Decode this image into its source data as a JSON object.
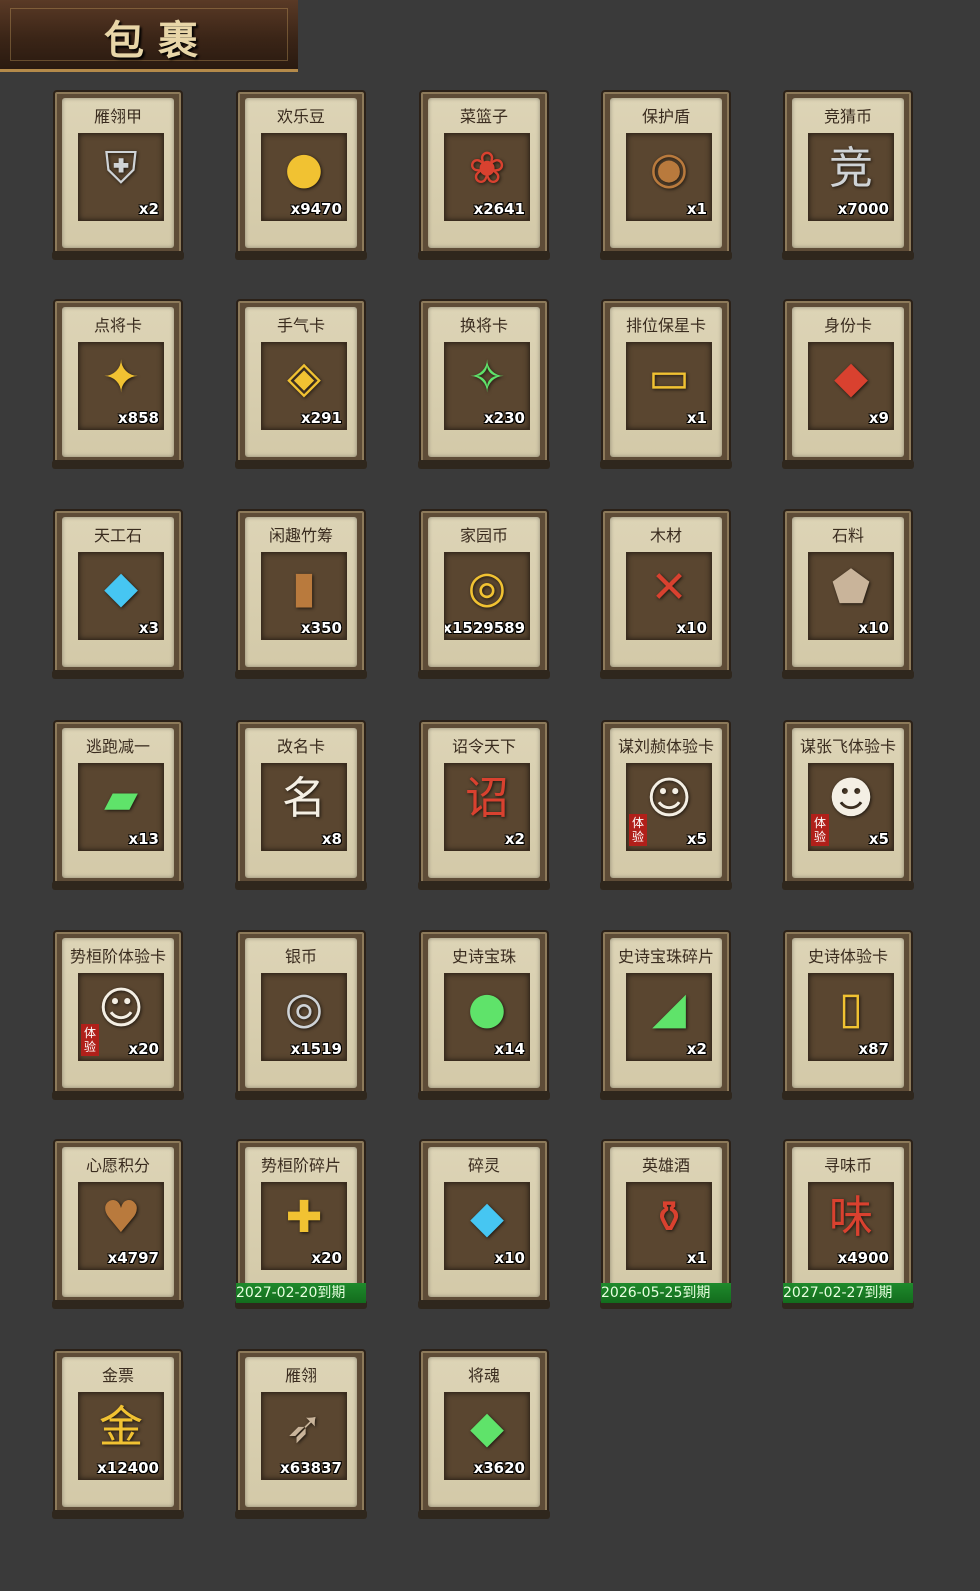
{
  "header": {
    "title": "包裹"
  },
  "items": [
    {
      "name": "雁翎甲",
      "qty": "x2",
      "icon": "armor-icon",
      "glyph": "⛨",
      "theme": "t-silver"
    },
    {
      "name": "欢乐豆",
      "qty": "x9470",
      "icon": "beans-icon",
      "glyph": "●",
      "theme": "t-gold"
    },
    {
      "name": "菜篮子",
      "qty": "x2641",
      "icon": "basket-icon",
      "glyph": "❀",
      "theme": "t-red"
    },
    {
      "name": "保护盾",
      "qty": "x1",
      "icon": "shield-icon",
      "glyph": "◉",
      "theme": "t-brown"
    },
    {
      "name": "竞猜币",
      "qty": "x7000",
      "icon": "coin-icon",
      "glyph": "竞",
      "theme": "t-silver"
    },
    {
      "name": "点将卡",
      "qty": "x858",
      "icon": "card-token-icon",
      "glyph": "✦",
      "theme": "t-gold"
    },
    {
      "name": "手气卡",
      "qty": "x291",
      "icon": "luck-card-icon",
      "glyph": "◈",
      "theme": "t-gold"
    },
    {
      "name": "换将卡",
      "qty": "x230",
      "icon": "swap-card-icon",
      "glyph": "✧",
      "theme": "t-green"
    },
    {
      "name": "排位保星卡",
      "qty": "x1",
      "icon": "rank-card-icon",
      "glyph": "▭",
      "theme": "t-gold"
    },
    {
      "name": "身份卡",
      "qty": "x9",
      "icon": "identity-card-icon",
      "glyph": "◆",
      "theme": "t-red"
    },
    {
      "name": "天工石",
      "qty": "x3",
      "icon": "crystal-icon",
      "glyph": "◆",
      "theme": "t-blue"
    },
    {
      "name": "闲趣竹筹",
      "qty": "x350",
      "icon": "bamboo-tally-icon",
      "glyph": "▮",
      "theme": "t-brown"
    },
    {
      "name": "家园币",
      "qty": "x1529589",
      "icon": "home-coin-icon",
      "glyph": "◎",
      "theme": "t-gold"
    },
    {
      "name": "木材",
      "qty": "x10",
      "icon": "wood-icon",
      "glyph": "✕",
      "theme": "t-red"
    },
    {
      "name": "石料",
      "qty": "x10",
      "icon": "stone-icon",
      "glyph": "⬟",
      "theme": "t-stone"
    },
    {
      "name": "逃跑减一",
      "qty": "x13",
      "icon": "tag-icon",
      "glyph": "▰",
      "theme": "t-green"
    },
    {
      "name": "改名卡",
      "qty": "x8",
      "icon": "rename-card-icon",
      "glyph": "名",
      "theme": "t-white"
    },
    {
      "name": "诏令天下",
      "qty": "x2",
      "icon": "scroll-icon",
      "glyph": "诏",
      "theme": "t-red"
    },
    {
      "name": "谋刘赪体验卡",
      "qty": "x5",
      "icon": "hero-portrait-icon",
      "glyph": "☺",
      "theme": "t-white",
      "tag": "体验"
    },
    {
      "name": "谋张飞体验卡",
      "qty": "x5",
      "icon": "hero-portrait-icon",
      "glyph": "☻",
      "theme": "t-white",
      "tag": "体验"
    },
    {
      "name": "势桓阶体验卡",
      "qty": "x20",
      "icon": "hero-portrait-icon",
      "glyph": "☺",
      "theme": "t-white",
      "tag": "体验"
    },
    {
      "name": "银币",
      "qty": "x1519",
      "icon": "silver-coin-icon",
      "glyph": "◎",
      "theme": "t-silver"
    },
    {
      "name": "史诗宝珠",
      "qty": "x14",
      "icon": "orb-icon",
      "glyph": "●",
      "theme": "t-green"
    },
    {
      "name": "史诗宝珠碎片",
      "qty": "x2",
      "icon": "orb-shard-icon",
      "glyph": "◢",
      "theme": "t-green"
    },
    {
      "name": "史诗体验卡",
      "qty": "x87",
      "icon": "gold-card-icon",
      "glyph": "▯",
      "theme": "t-gold"
    },
    {
      "name": "心愿积分",
      "qty": "x4797",
      "icon": "heart-coin-icon",
      "glyph": "♥",
      "theme": "t-brown"
    },
    {
      "name": "势桓阶碎片",
      "qty": "x20",
      "icon": "puzzle-piece-icon",
      "glyph": "✚",
      "theme": "t-gold",
      "expiry": "2027-02-20到期"
    },
    {
      "name": "碎灵",
      "qty": "x10",
      "icon": "shard-crystal-icon",
      "glyph": "◆",
      "theme": "t-blue"
    },
    {
      "name": "英雄酒",
      "qty": "x1",
      "icon": "wine-jar-icon",
      "glyph": "⚱",
      "theme": "t-red",
      "expiry": "2026-05-25到期"
    },
    {
      "name": "寻味币",
      "qty": "x4900",
      "icon": "flavor-coin-icon",
      "glyph": "味",
      "theme": "t-red",
      "expiry": "2027-02-27到期"
    },
    {
      "name": "金票",
      "qty": "x12400",
      "icon": "gold-ticket-icon",
      "glyph": "金",
      "theme": "t-gold"
    },
    {
      "name": "雁翎",
      "qty": "x63837",
      "icon": "feather-icon",
      "glyph": "➶",
      "theme": "t-stone"
    },
    {
      "name": "将魂",
      "qty": "x3620",
      "icon": "soul-gem-icon",
      "glyph": "◆",
      "theme": "t-green"
    }
  ]
}
